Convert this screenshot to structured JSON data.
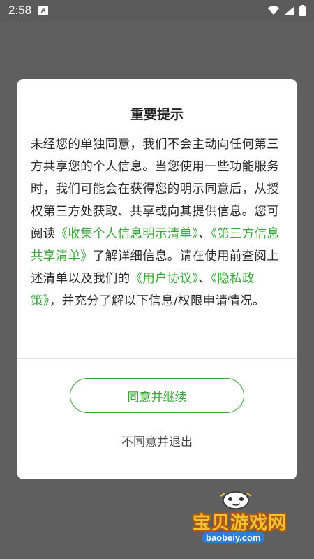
{
  "status_bar": {
    "time": "2:58",
    "notification_icon": "A"
  },
  "dialog": {
    "title": "重要提示",
    "body": {
      "p1": "未经您的单独同意，我们不会主动向任何第三方共享您的个人信息。当您使用一些功能服务时，我们可能会在获得您的明示同意后，从授权第三方处获取、共享或向其提供信息。您可阅读",
      "link_collection": "《收集个人信息明示清单》",
      "sep1": "、",
      "link_third_party": "《第三方信息共享清单》",
      "p2": "了解详细信息。请在使用前查阅上述清单以及我们的",
      "link_user_agreement": "《用户协议》",
      "sep2": "、",
      "link_privacy": "《隐私政策》",
      "p3": "，并充分了解以下信息/权限申请情况。"
    },
    "agree_label": "同意并继续",
    "disagree_label": "不同意并退出",
    "accent_color": "#3aa43a"
  },
  "watermark": {
    "name": "宝贝游戏网",
    "url": "baobeiy.com"
  }
}
